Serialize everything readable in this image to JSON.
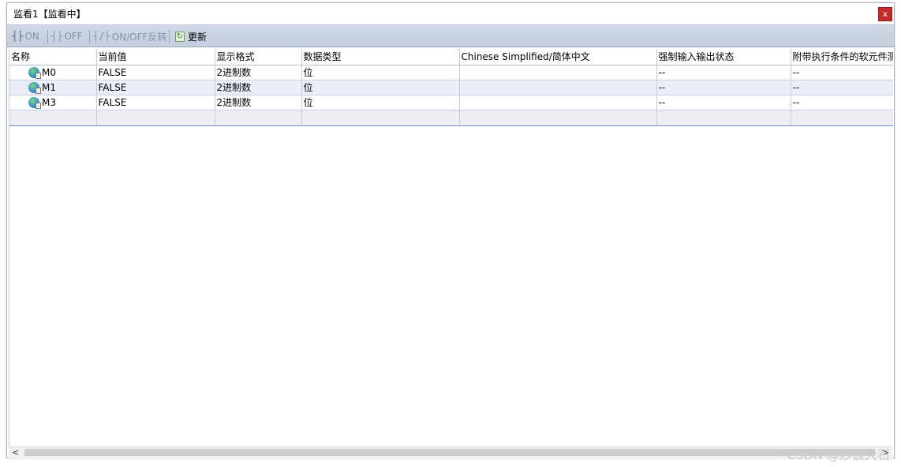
{
  "window": {
    "title": "监看1【监看中】",
    "close_label": "x"
  },
  "toolbar": {
    "on_label": "ON",
    "off_label": "OFF",
    "toggle_label": "ON/OFF反转",
    "refresh_label": "更新"
  },
  "table": {
    "columns": [
      "名称",
      "当前值",
      "显示格式",
      "数据类型",
      "Chinese Simplified/简体中文",
      "强制输入输出状态",
      "附带执行条件的软元件测试"
    ],
    "rows": [
      {
        "name": "M0",
        "value": "FALSE",
        "format": "2进制数",
        "type": "位",
        "comment": "",
        "force": "--",
        "cond": "--"
      },
      {
        "name": "M1",
        "value": "FALSE",
        "format": "2进制数",
        "type": "位",
        "comment": "",
        "force": "--",
        "cond": "--"
      },
      {
        "name": "M3",
        "value": "FALSE",
        "format": "2进制数",
        "type": "位",
        "comment": "",
        "force": "--",
        "cond": "--"
      }
    ]
  },
  "scrollbar": {
    "left_arrow": "<",
    "right_arrow": ">"
  },
  "watermark": "CSDN @炒饭大石",
  "colors": {
    "toolbar_bg": "#c4cede",
    "row_alt": "#e9eef8",
    "close_red": "#c42b2b"
  }
}
